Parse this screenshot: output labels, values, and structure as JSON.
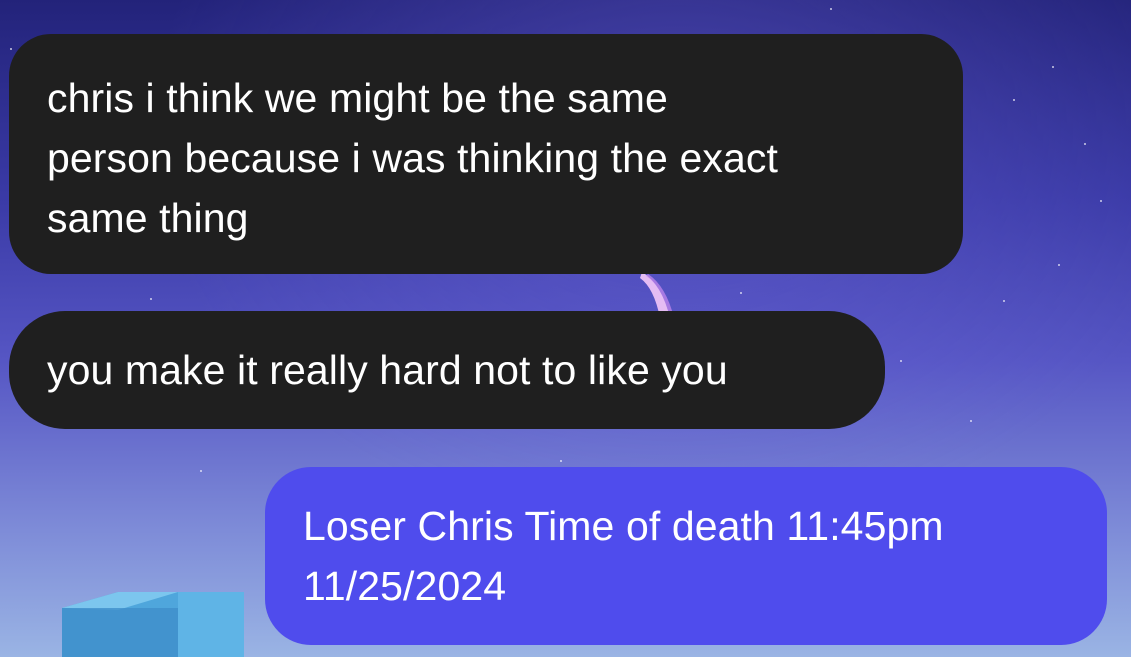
{
  "conversation": {
    "messages": [
      {
        "direction": "received",
        "text": "chris i think we might be the same\nperson because i was thinking the exact\nsame thing"
      },
      {
        "direction": "received",
        "text": "you make it really hard not to like you"
      },
      {
        "direction": "sent",
        "text": "Loser Chris Time of death 11:45pm\n11/25/2024"
      }
    ]
  },
  "theme": {
    "received_bubble_color": "#1f1f1f",
    "sent_bubble_color": "#4f4ced",
    "text_color": "#ffffff"
  }
}
